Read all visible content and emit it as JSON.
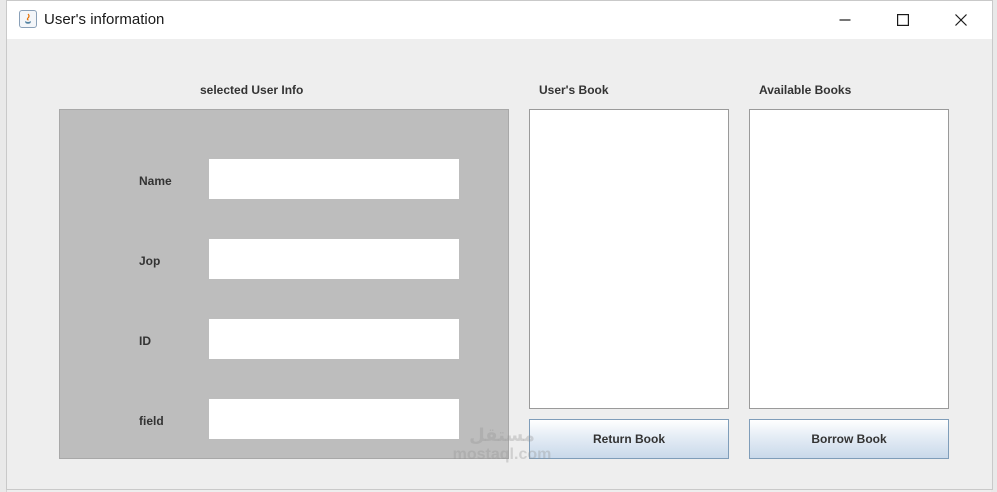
{
  "window": {
    "title": "User's information",
    "controls": {
      "minimize": "minimize-icon",
      "maximize": "maximize-icon",
      "close": "close-icon"
    }
  },
  "user_info": {
    "heading": "selected User Info",
    "fields": [
      {
        "label": "Name",
        "value": ""
      },
      {
        "label": "Jop",
        "value": ""
      },
      {
        "label": "ID",
        "value": ""
      },
      {
        "label": "field",
        "value": ""
      }
    ]
  },
  "users_books": {
    "heading": "User's Book",
    "items": [],
    "button_label": "Return Book"
  },
  "available_books": {
    "heading": "Available Books",
    "items": [],
    "button_label": "Borrow Book"
  },
  "watermark": {
    "top": "مستقل",
    "bottom": "mostaql.com"
  },
  "colors": {
    "panel_gray": "#bdbdbd",
    "window_bg": "#eeeeee",
    "button_gradient_end": "#c9d9ea"
  }
}
